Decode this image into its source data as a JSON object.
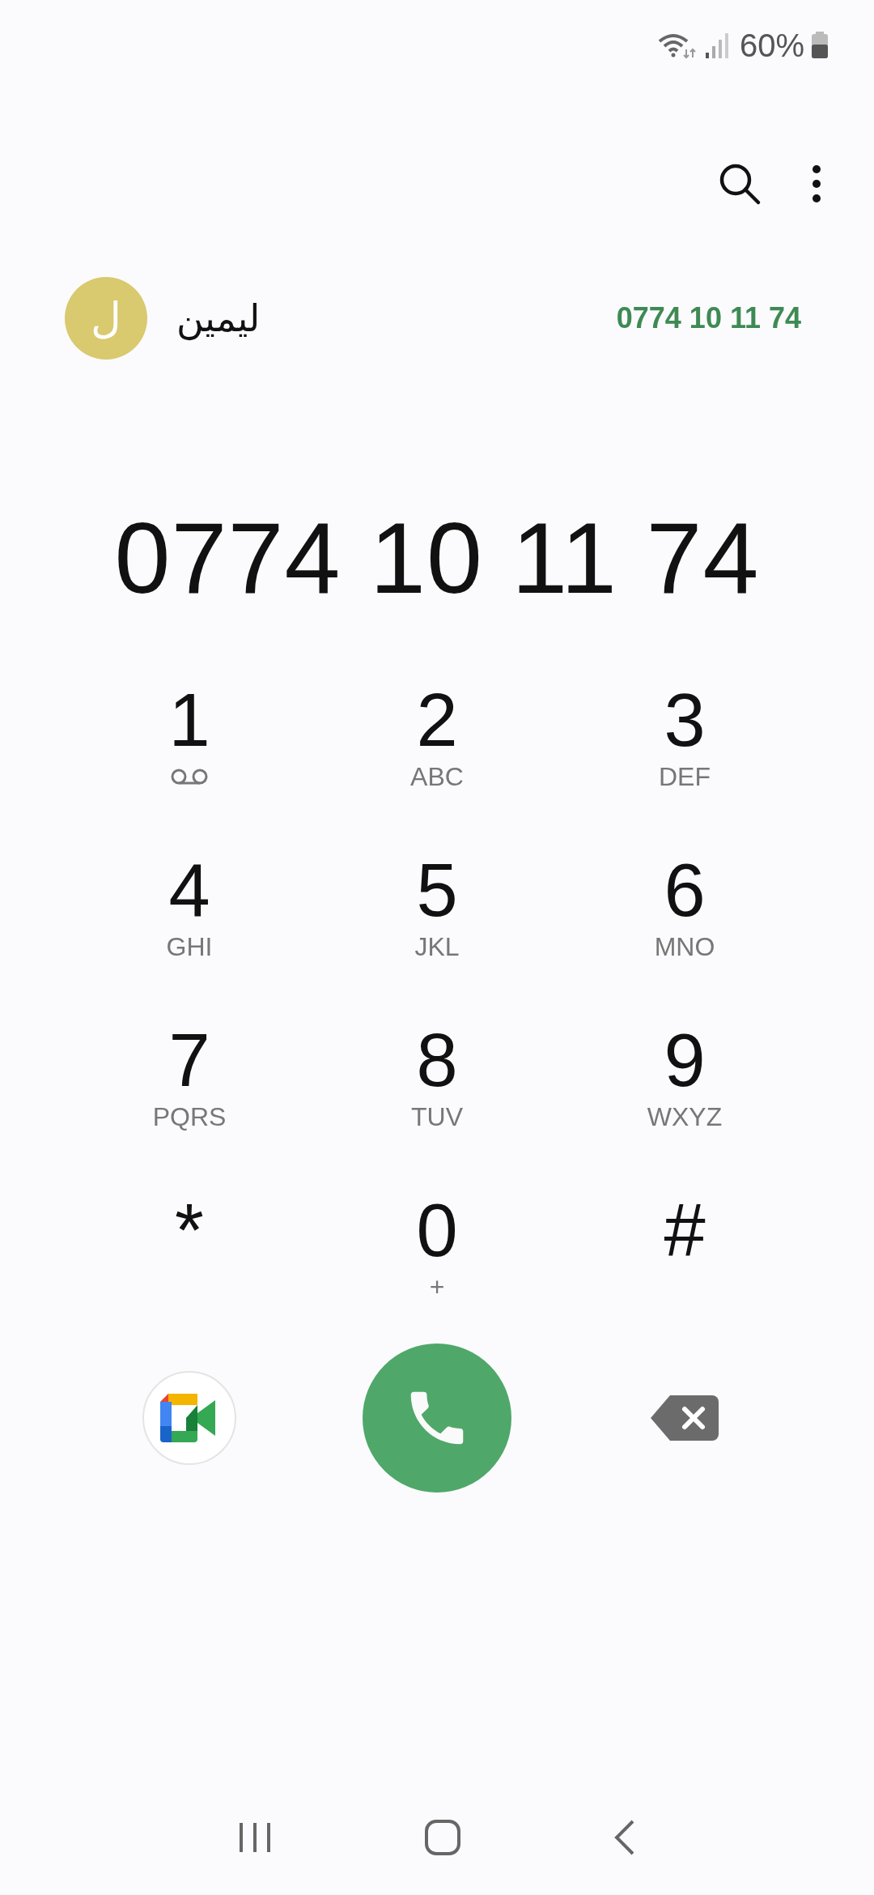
{
  "status_bar": {
    "battery": "60%"
  },
  "suggestion": {
    "avatar_letter": "ل",
    "name": "ليمين",
    "number": "0774 10 11 74"
  },
  "dialed_number": "0774 10 11 74",
  "keys": [
    {
      "digit": "1",
      "kind": "voicemail"
    },
    {
      "digit": "2",
      "kind": "letters",
      "sub": "ABC"
    },
    {
      "digit": "3",
      "kind": "letters",
      "sub": "DEF"
    },
    {
      "digit": "4",
      "kind": "letters",
      "sub": "GHI"
    },
    {
      "digit": "5",
      "kind": "letters",
      "sub": "JKL"
    },
    {
      "digit": "6",
      "kind": "letters",
      "sub": "MNO"
    },
    {
      "digit": "7",
      "kind": "letters",
      "sub": "PQRS"
    },
    {
      "digit": "8",
      "kind": "letters",
      "sub": "TUV"
    },
    {
      "digit": "9",
      "kind": "letters",
      "sub": "WXYZ"
    },
    {
      "digit": "*",
      "kind": "plain"
    },
    {
      "digit": "0",
      "kind": "letters",
      "sub": "+"
    },
    {
      "digit": "#",
      "kind": "plain"
    }
  ]
}
